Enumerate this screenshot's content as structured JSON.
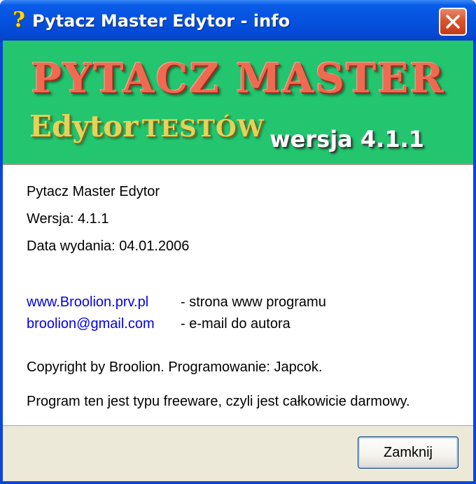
{
  "window": {
    "title": "Pytacz Master Edytor - info",
    "title_icon": "question-mark-icon"
  },
  "banner": {
    "title": "PYTACZ MASTER",
    "subtitle_big": "Edytor",
    "subtitle_small": "TESTÓW",
    "version": "wersja 4.1.1"
  },
  "info": {
    "name": "Pytacz Master Edytor",
    "version_line": "Wersja: 4.1.1",
    "release_line": "Data wydania: 04.01.2006"
  },
  "links": [
    {
      "text": "www.Broolion.prv.pl",
      "desc": "- strona www programu"
    },
    {
      "text": "broolion@gmail.com",
      "desc": "- e-mail do autora"
    }
  ],
  "copyright": "Copyright by Broolion. Programowanie: Japcok.",
  "license": "Program ten jest typu freeware, czyli jest całkowicie darmowy.",
  "footer": {
    "close_label": "Zamknij"
  },
  "colors": {
    "titlebar": "#0553e0",
    "banner_bg": "#23c56e",
    "banner_title": "#ee6b52",
    "banner_subtitle": "#e3d35c",
    "link": "#0000ee",
    "close_red": "#d9552f"
  }
}
